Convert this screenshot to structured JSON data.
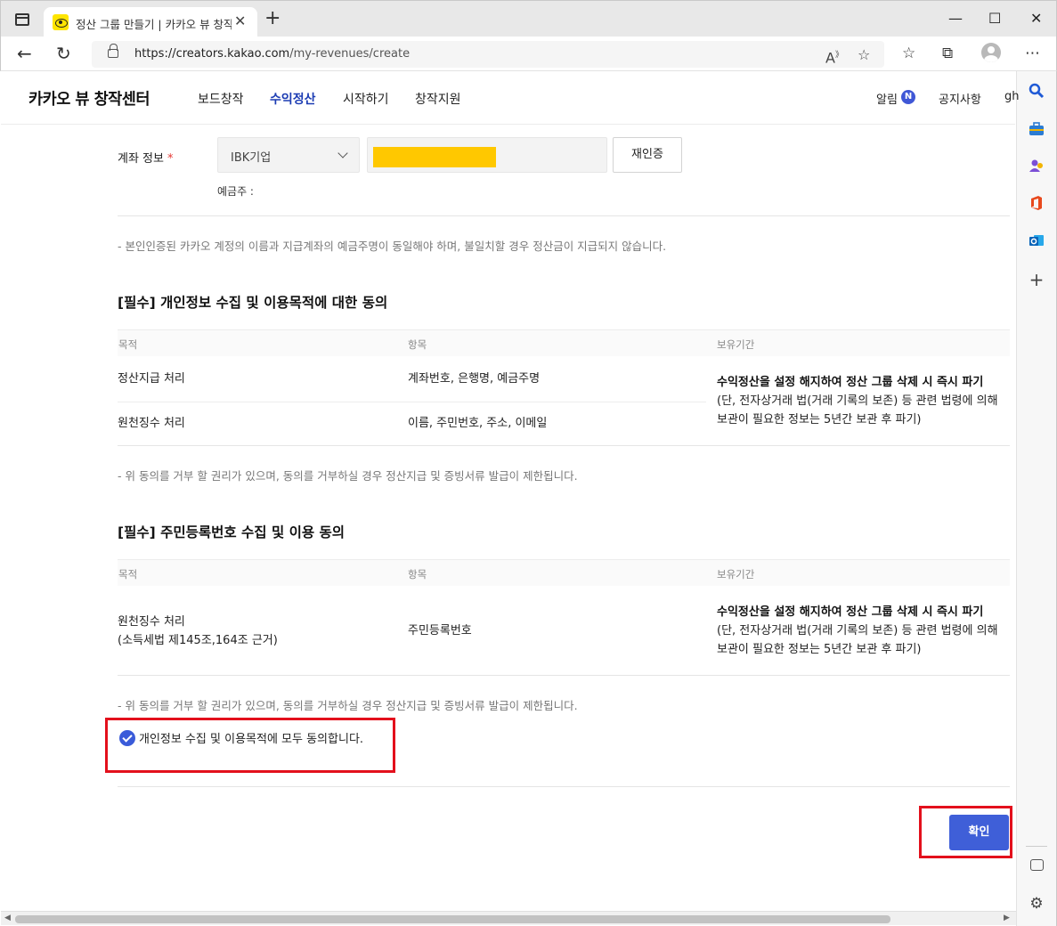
{
  "browser": {
    "tab_title": "정산 그룹 만들기 | 카카오 뷰 창작센터",
    "tab_close": "✕",
    "new_tab": "+",
    "window_controls": [
      "—",
      "☐",
      "✕"
    ],
    "url_host": "https://creators.kakao.com",
    "url_path": "/my-revenues/create",
    "icons": [
      "tab-actions-icon",
      "back-icon",
      "refresh-icon",
      "lock-icon",
      "read-aloud-icon",
      "add-favorite-icon",
      "favorites-icon",
      "collections-icon",
      "profile-icon",
      "more-icon"
    ]
  },
  "sidebar": {
    "icons": [
      "search-icon",
      "shopping-icon",
      "people-icon",
      "office-icon",
      "outlook-icon",
      "add-icon",
      "hide-sidebar-icon",
      "settings-icon"
    ]
  },
  "header": {
    "logo": "카카오 뷰 창작센터",
    "nav": [
      "보드창작",
      "수익정산",
      "시작하기",
      "창작지원"
    ],
    "active_nav": "수익정산",
    "alarm": "알림",
    "alarm_badge": "N",
    "notice": "공지사항",
    "user_partial": "gh"
  },
  "account": {
    "label": "계좌 정보",
    "required_mark": "*",
    "bank": "IBK기업",
    "account_number_redacted": true,
    "reauth_button": "재인증",
    "depositor_label": "예금주 :"
  },
  "notices": {
    "name_match": "- 본인인증된 카카오 계정의 이름과 지급계좌의 예금주명이 동일해야 하며, 불일치할 경우 정산금이 지급되지 않습니다.",
    "refuse_right": "- 위 동의를 거부 할 권리가 있으며, 동의를 거부하실 경우 정산지급 및 증빙서류 발급이 제한됩니다."
  },
  "consent1": {
    "title": "[필수] 개인정보 수집 및 이용목적에 대한 동의",
    "headers": [
      "목적",
      "항목",
      "보유기간"
    ],
    "rows": [
      {
        "purpose": "정산지급 처리",
        "items": "계좌번호, 은행명, 예금주명"
      },
      {
        "purpose": "원천징수 처리",
        "items": "이름, 주민번호, 주소, 이메일"
      }
    ],
    "retention_bold": "수익정산을 설정 해지하여 정산 그룹 삭제 시 즉시 파기",
    "retention_detail_1": "(단, 전자상거래 법(거래 기록의 보존) 등 관련 법령에 의해",
    "retention_detail_2": "보관이 필요한 정보는 5년간 보관 후 파기)"
  },
  "consent2": {
    "title": "[필수] 주민등록번호 수집 및 이용 동의",
    "headers": [
      "목적",
      "항목",
      "보유기간"
    ],
    "purpose_1": "원천징수 처리",
    "purpose_2": "(소득세법 제145조,164조 근거)",
    "items": "주민등록번호",
    "retention_bold": "수익정산을 설정 해지하여 정산 그룹 삭제 시 즉시 파기",
    "retention_detail_1": "(단, 전자상거래 법(거래 기록의 보존) 등 관련 법령에 의해",
    "retention_detail_2": "보관이 필요한 정보는 5년간 보관 후 파기)"
  },
  "agreement": {
    "label": "개인정보 수집 및 이용목적에 모두 동의합니다.",
    "checked": true
  },
  "confirm_button": "확인",
  "colors": {
    "accent": "#3f5fd8",
    "nav_active": "#1c3cb3",
    "highlight_box": "#e3101c",
    "redaction": "#ffc800",
    "required": "#e53935"
  }
}
